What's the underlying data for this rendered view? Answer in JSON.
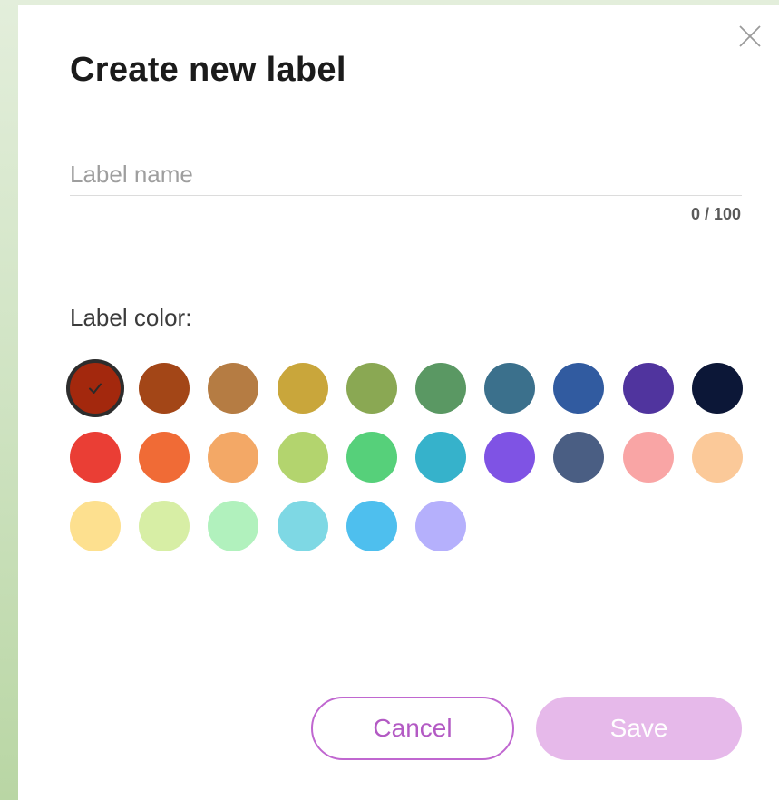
{
  "dialog": {
    "title": "Create new label",
    "close_icon": "close-icon"
  },
  "name_field": {
    "value": "",
    "placeholder": "Label name",
    "counter": "0 / 100"
  },
  "color_section": {
    "label": "Label color:",
    "selected_index": 0,
    "check_icon": "check-icon",
    "colors": [
      "#a3280d",
      "#a34617",
      "#b57c43",
      "#c9a63b",
      "#8aa853",
      "#5a9863",
      "#3b708c",
      "#315ba0",
      "#50349e",
      "#0c1737",
      "#ea3e35",
      "#f06b36",
      "#f3a866",
      "#b3d46e",
      "#56d07a",
      "#36b2cb",
      "#7f53e4",
      "#4a5e83",
      "#f9a5a5",
      "#fbc999",
      "#fde08f",
      "#d7eea5",
      "#b1f1bd",
      "#7ed8e4",
      "#4ebfee",
      "#b5b0fc"
    ]
  },
  "actions": {
    "cancel_label": "Cancel",
    "save_label": "Save"
  },
  "theme": {
    "accent": "#c067d0",
    "save_disabled_bg": "#e6b9ea"
  }
}
